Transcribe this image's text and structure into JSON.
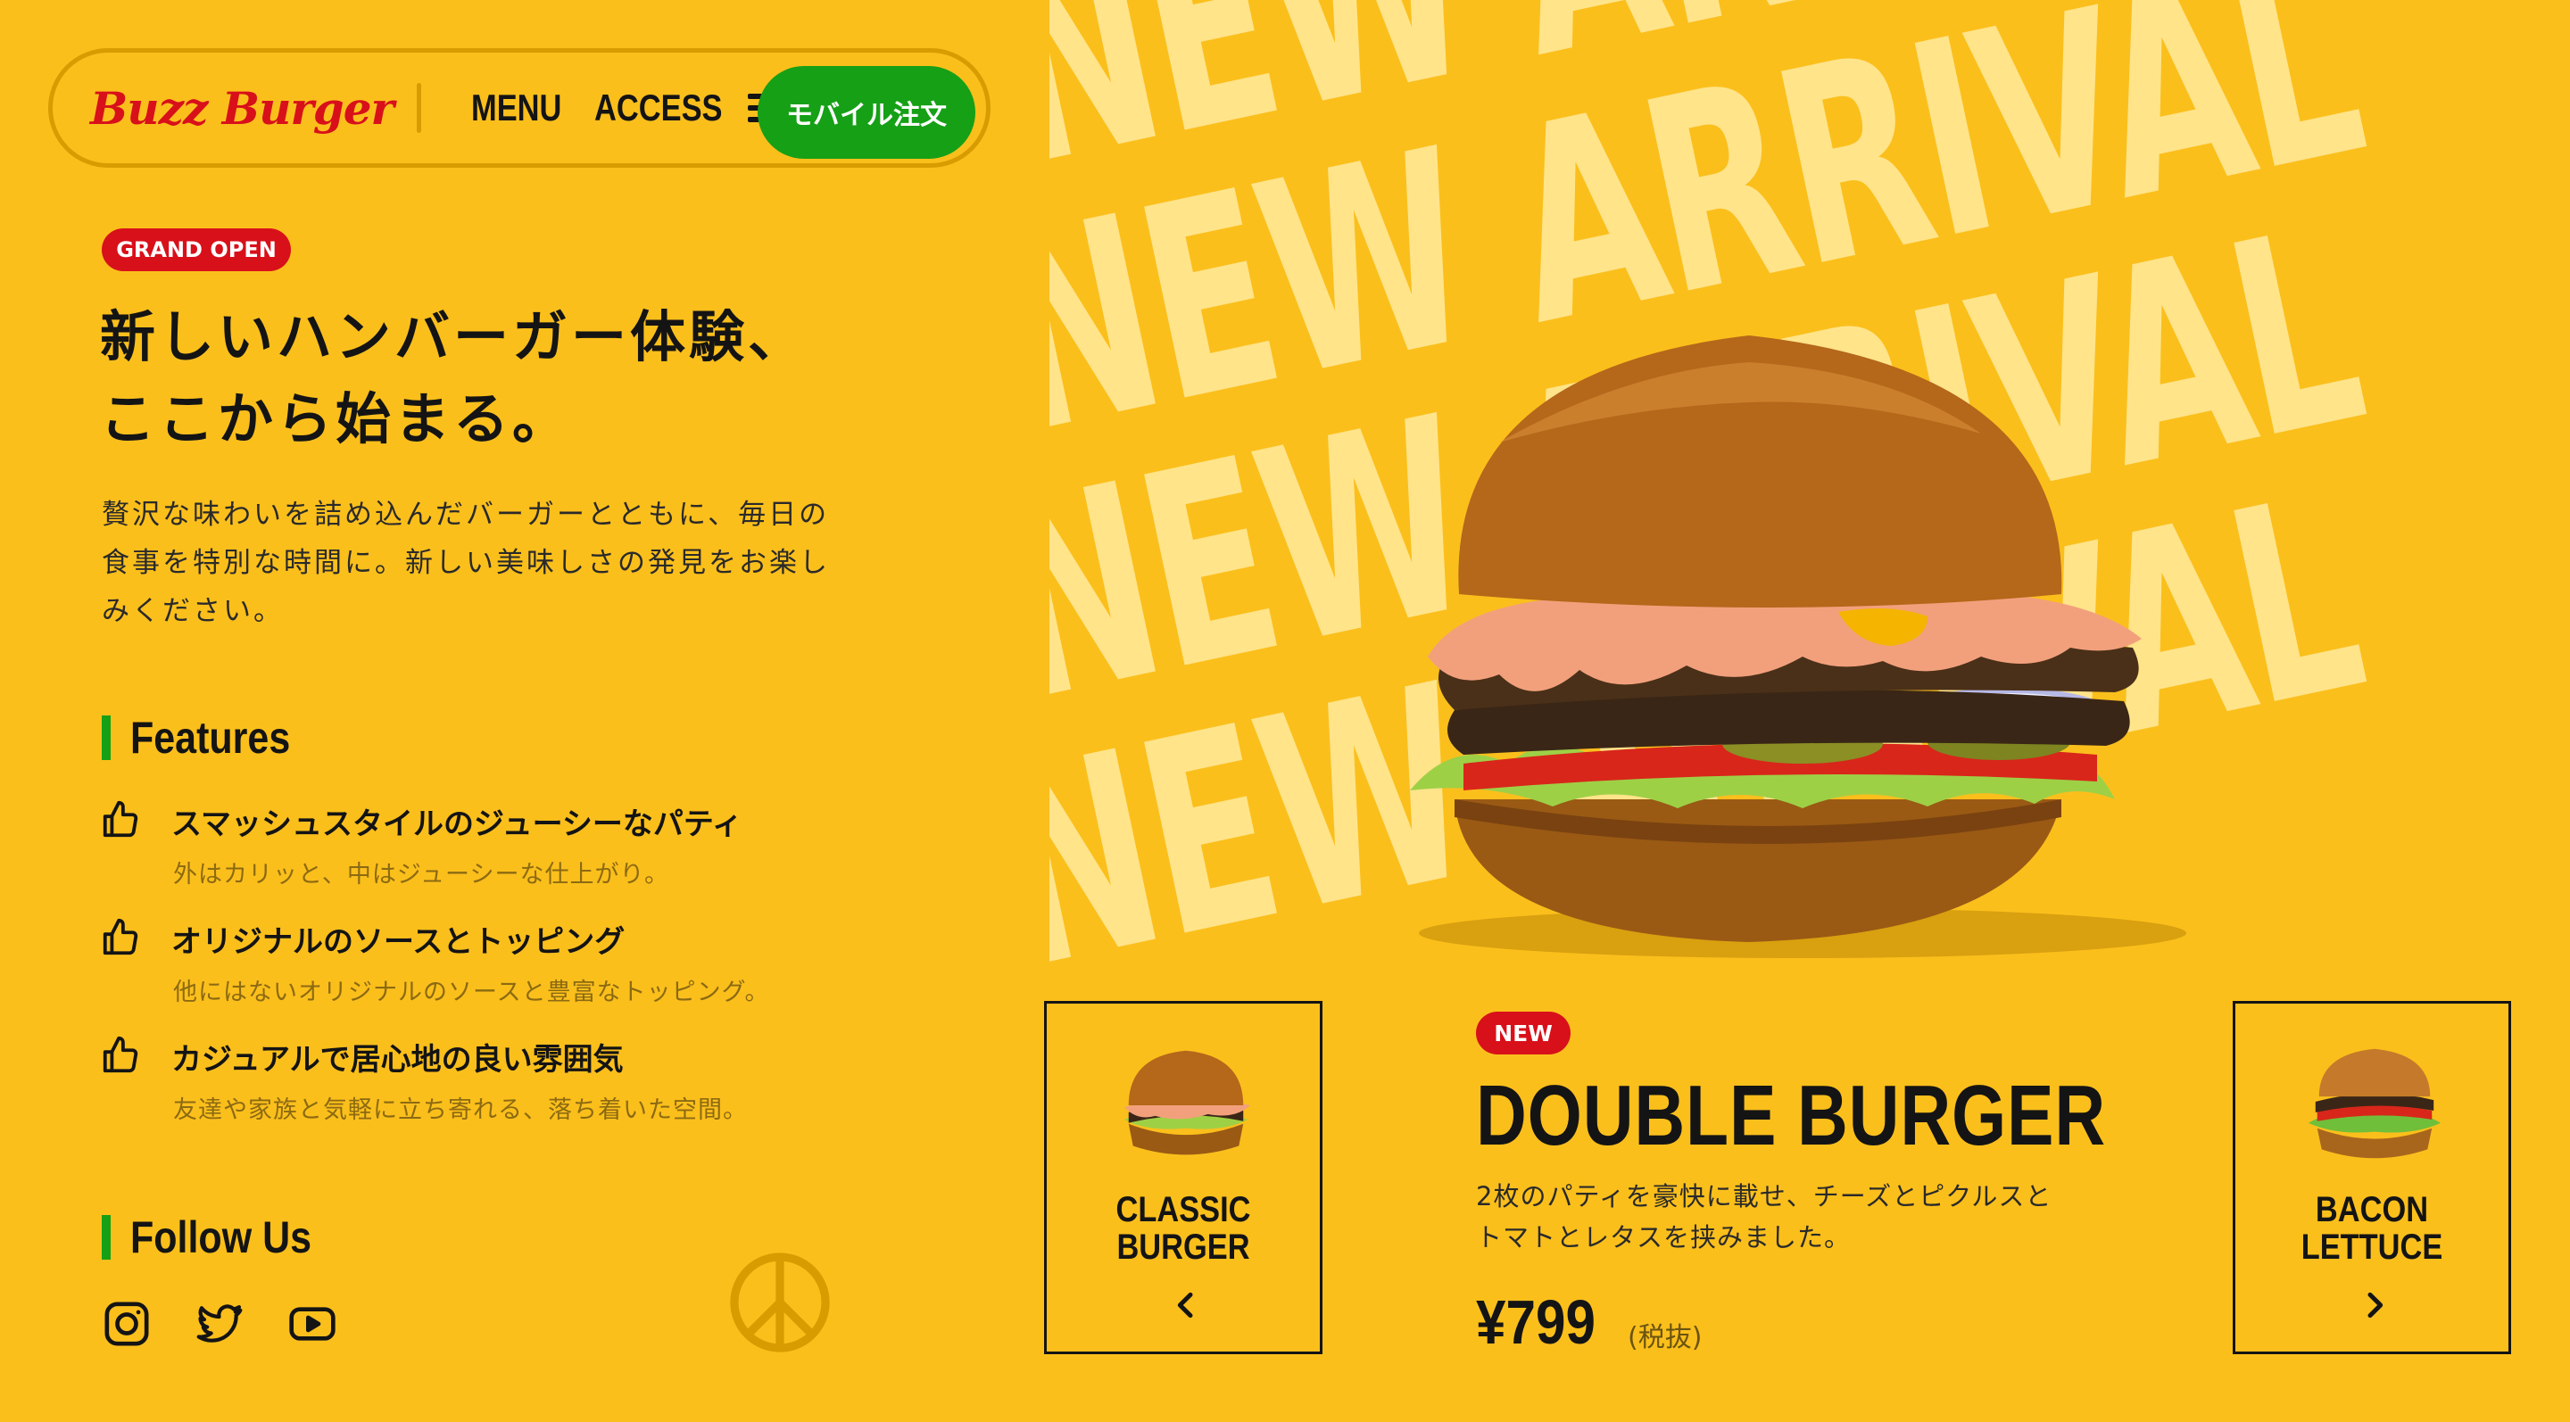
{
  "header": {
    "logo_text": "Buzz Burger",
    "nav": [
      {
        "label": "MENU"
      },
      {
        "label": "ACCESS"
      }
    ],
    "menu_icon": "hamburger-menu-icon",
    "mobile_order_label": "モバイル注文"
  },
  "hero": {
    "badge": "GRAND OPEN",
    "headline_line1": "新しいハンバーガー体験、",
    "headline_line2": "ここから始まる。",
    "lead": "贅沢な味わいを詰め込んだバーガーとともに、毎日の食事を特別な時間に。新しい美味しさの発見をお楽しみください。"
  },
  "features": {
    "title": "Features",
    "items": [
      {
        "icon": "thumbs-up-icon",
        "title": "スマッシュスタイルのジューシーなパティ",
        "desc": "外はカリッと、中はジューシーな仕上がり。"
      },
      {
        "icon": "thumbs-up-icon",
        "title": "オリジナルのソースとトッピング",
        "desc": "他にはないオリジナルのソースと豊富なトッピング。"
      },
      {
        "icon": "thumbs-up-icon",
        "title": "カジュアルで居心地の良い雰囲気",
        "desc": "友達や家族と気軽に立ち寄れる、落ち着いた空間。"
      }
    ]
  },
  "follow": {
    "title": "Follow Us",
    "icons": [
      "instagram-icon",
      "twitter-icon",
      "youtube-icon"
    ]
  },
  "showcase": {
    "background_text": "NEW ARRIVAL",
    "prev_card": {
      "label_line1": "CLASSIC",
      "label_line2": "BURGER",
      "arrow": "chevron-left-icon"
    },
    "next_card": {
      "label_line1": "BACON",
      "label_line2": "LETTUCE",
      "arrow": "chevron-right-icon"
    },
    "product": {
      "badge": "NEW",
      "name": "DOUBLE BURGER",
      "desc_line1": "2枚のパティを豪快に載せ、チーズとピクルスと",
      "desc_line2": "トマトとレタスを挟みました。",
      "price": "¥799",
      "tax_note": "(税抜)"
    }
  },
  "colors": {
    "background": "#fbbf1c",
    "accent_red": "#d8101a",
    "accent_green": "#16a016",
    "background_text": "#ffe48a"
  }
}
